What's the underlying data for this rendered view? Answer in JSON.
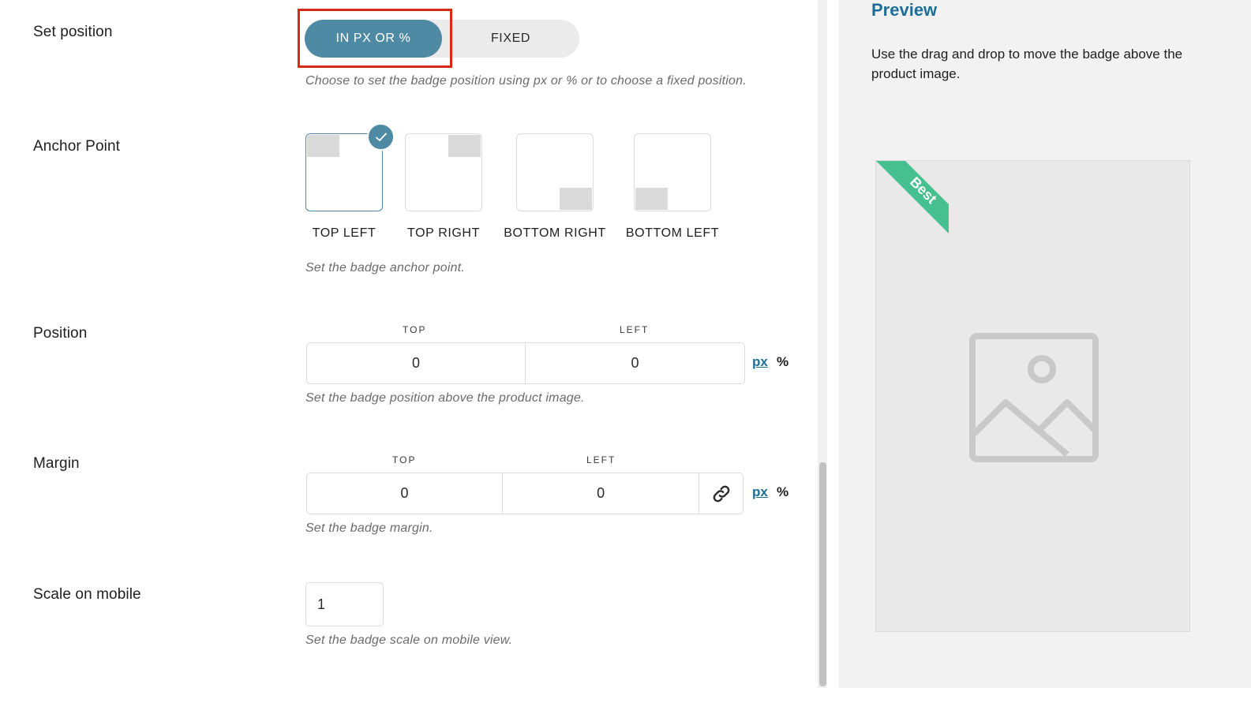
{
  "set_position": {
    "label": "Set position",
    "options": [
      "IN PX OR %",
      "FIXED"
    ],
    "selected": "IN PX OR %",
    "help": "Choose to set the badge position using px or % or to choose a fixed position."
  },
  "anchor_point": {
    "label": "Anchor Point",
    "options": [
      "TOP LEFT",
      "TOP RIGHT",
      "BOTTOM RIGHT",
      "BOTTOM LEFT"
    ],
    "selected": "TOP LEFT",
    "help": "Set the badge anchor point."
  },
  "position": {
    "label": "Position",
    "top_label": "TOP",
    "left_label": "LEFT",
    "top_value": "0",
    "left_value": "0",
    "unit_px": "px",
    "unit_pct": "%",
    "help": "Set the badge position above the product image."
  },
  "margin": {
    "label": "Margin",
    "top_label": "TOP",
    "left_label": "LEFT",
    "top_value": "0",
    "left_value": "0",
    "link_icon": "link-icon",
    "unit_px": "px",
    "unit_pct": "%",
    "help": "Set the badge margin."
  },
  "scale_on_mobile": {
    "label": "Scale on mobile",
    "value": "1",
    "help": "Set the badge scale on mobile view."
  },
  "preview": {
    "title": "Preview",
    "description": "Use the drag and drop to move the badge above the product image.",
    "badge_text": "Best",
    "badge_color": "#45c08e",
    "placeholder_icon": "image-placeholder-icon"
  },
  "colors": {
    "accent": "#4f8aa5",
    "link": "#1c6e96",
    "highlight": "#d62a17"
  }
}
